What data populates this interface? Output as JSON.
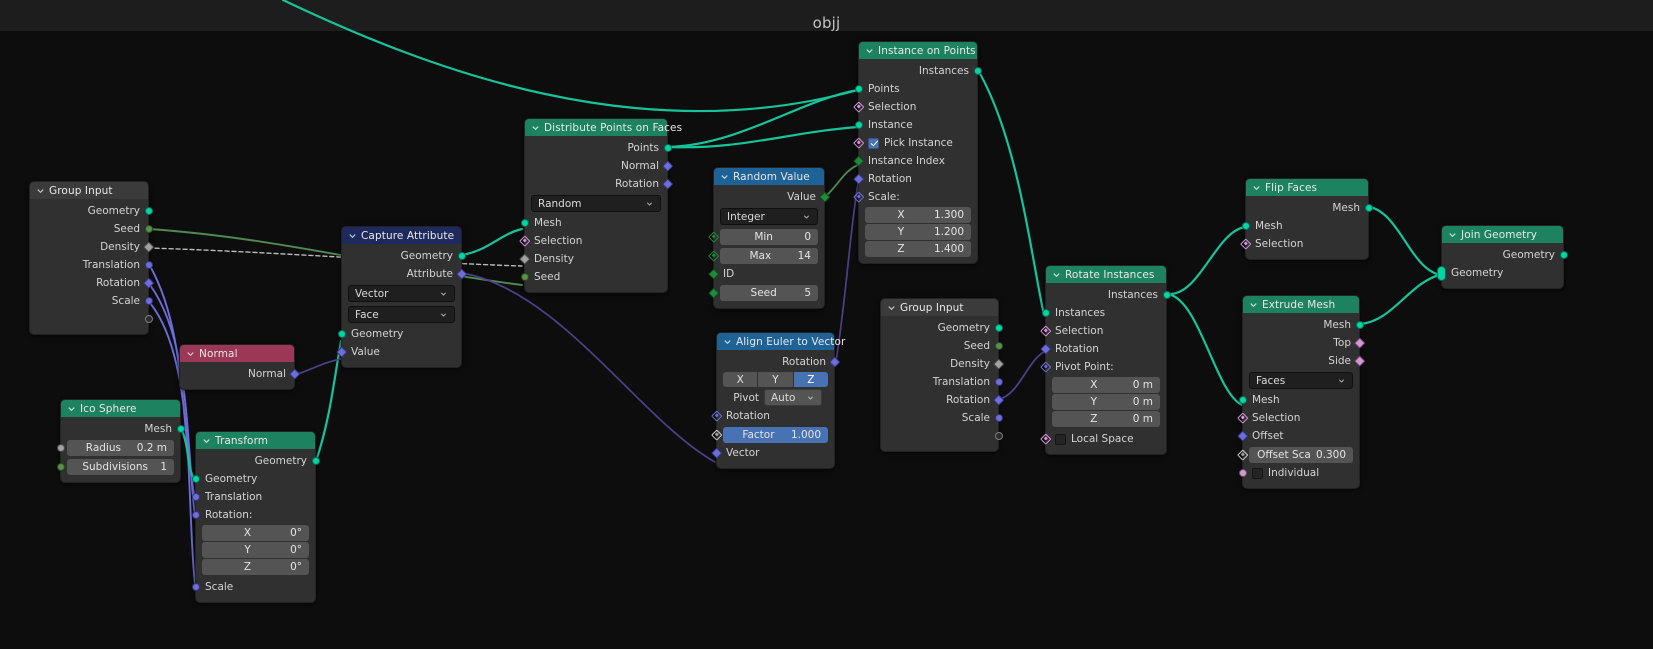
{
  "editor": {
    "breadcrumb": "objj",
    "background_color": "#0d0d0d",
    "header_color": "#1d1d1d"
  },
  "colors": {
    "geometry_header": "#1d825f",
    "attribute_header": "#1e2a5e",
    "converter_header": "#1e6296",
    "input_header": "#3b3b3b",
    "input_red_header": "#9b3757",
    "accent_blue": "#4772b3",
    "socket_geometry": "#00d6a3",
    "socket_vector": "#6d6ddb",
    "socket_boolean": "#d993d9",
    "socket_integer": "#1e8a3a",
    "socket_float": "#a1a1a1"
  },
  "nodes": {
    "group_input_1": {
      "title": "Group Input",
      "outputs": [
        "Geometry",
        "Seed",
        "Density",
        "Translation",
        "Rotation",
        "Scale"
      ]
    },
    "normal": {
      "title": "Normal",
      "outputs": [
        "Normal"
      ]
    },
    "ico_sphere": {
      "title": "Ico Sphere",
      "outputs": [
        "Mesh"
      ],
      "fields": [
        {
          "label": "Radius",
          "value": "0.2 m"
        },
        {
          "label": "Subdivisions",
          "value": "1"
        }
      ]
    },
    "transform": {
      "title": "Transform",
      "outputs": [
        "Geometry"
      ],
      "inputs": [
        "Geometry",
        "Translation",
        "Rotation:"
      ],
      "rotation": [
        {
          "label": "X",
          "value": "0°"
        },
        {
          "label": "Y",
          "value": "0°"
        },
        {
          "label": "Z",
          "value": "0°"
        }
      ],
      "scale_label": "Scale"
    },
    "capture_attribute": {
      "title": "Capture Attribute",
      "outputs": [
        "Geometry",
        "Attribute"
      ],
      "data_type": "Vector",
      "domain": "Face",
      "inputs": [
        "Geometry",
        "Value"
      ]
    },
    "distribute_points": {
      "title": "Distribute Points on Faces",
      "outputs": [
        "Points",
        "Normal",
        "Rotation"
      ],
      "method": "Random",
      "inputs": [
        "Mesh",
        "Selection",
        "Density",
        "Seed"
      ]
    },
    "random_value": {
      "title": "Random Value",
      "outputs": [
        "Value"
      ],
      "data_type": "Integer",
      "fields": [
        {
          "label": "Min",
          "value": "0"
        },
        {
          "label": "Max",
          "value": "14"
        }
      ],
      "inputs": [
        "ID"
      ],
      "seed": {
        "label": "Seed",
        "value": "5"
      }
    },
    "align_euler": {
      "title": "Align Euler to Vector",
      "outputs": [
        "Rotation"
      ],
      "axis_options": [
        "X",
        "Y",
        "Z"
      ],
      "axis_selected": "Z",
      "pivot_label": "Pivot",
      "pivot_value": "Auto",
      "inputs": [
        "Rotation"
      ],
      "factor": {
        "label": "Factor",
        "value": "1.000"
      },
      "vector_label": "Vector"
    },
    "instance_on_points": {
      "title": "Instance on Points",
      "outputs": [
        "Instances"
      ],
      "inputs": [
        "Points",
        "Selection",
        "Instance"
      ],
      "pick_instance": {
        "label": "Pick Instance",
        "checked": true
      },
      "inputs2": [
        "Instance Index",
        "Rotation"
      ],
      "scale_label": "Scale:",
      "scale": [
        {
          "label": "X",
          "value": "1.300"
        },
        {
          "label": "Y",
          "value": "1.200"
        },
        {
          "label": "Z",
          "value": "1.400"
        }
      ]
    },
    "group_input_2": {
      "title": "Group Input",
      "outputs": [
        "Geometry",
        "Seed",
        "Density",
        "Translation",
        "Rotation",
        "Scale"
      ]
    },
    "rotate_instances": {
      "title": "Rotate Instances",
      "outputs": [
        "Instances"
      ],
      "inputs": [
        "Instances",
        "Selection",
        "Rotation"
      ],
      "pivot_label": "Pivot Point:",
      "pivot": [
        {
          "label": "X",
          "value": "0 m"
        },
        {
          "label": "Y",
          "value": "0 m"
        },
        {
          "label": "Z",
          "value": "0 m"
        }
      ],
      "local_space": {
        "label": "Local Space",
        "checked": false
      }
    },
    "flip_faces": {
      "title": "Flip Faces",
      "outputs": [
        "Mesh"
      ],
      "inputs": [
        "Mesh",
        "Selection"
      ]
    },
    "extrude_mesh": {
      "title": "Extrude Mesh",
      "outputs": [
        "Mesh",
        "Top",
        "Side"
      ],
      "mode": "Faces",
      "inputs": [
        "Mesh",
        "Selection",
        "Offset"
      ],
      "offset_scale": {
        "label": "Offset Sca",
        "value": "0.300"
      },
      "individual": {
        "label": "Individual",
        "checked": false
      }
    },
    "join_geometry": {
      "title": "Join Geometry",
      "outputs": [
        "Geometry"
      ],
      "inputs": [
        "Geometry"
      ]
    }
  }
}
